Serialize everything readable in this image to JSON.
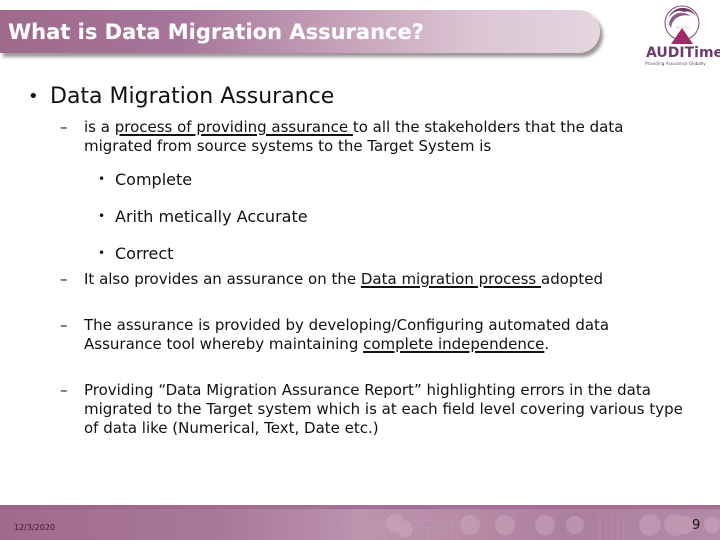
{
  "slide": {
    "title": "What is Data Migration Assurance?",
    "colors": {
      "banner_start": "#9e6a8c",
      "banner_end": "#e4d6df",
      "title_text": "#ffffff",
      "logo_purple": "#6d3c6c",
      "logo_magenta": "#a02a6a",
      "footer": "#a8789a"
    }
  },
  "logo": {
    "icon": "auditime-logo-icon",
    "name": "AUDITime",
    "tagline": "Providing Assurance Globally"
  },
  "content": {
    "heading": "Data Migration Assurance",
    "items": [
      {
        "pre": "is a ",
        "underlined": "process of providing assurance ",
        "post": "to all the stakeholders that the data migrated from source systems to the Target System is"
      },
      {
        "pre": "It also provides an assurance on the ",
        "underlined": "Data migration process ",
        "post": "adopted"
      },
      {
        "pre": "The assurance is provided by developing/Configuring automated data Assurance tool whereby maintaining ",
        "underlined": "complete independence",
        "post": "."
      },
      {
        "pre": "Providing “Data Migration Assurance Report” highlighting errors in the data migrated to the Target system which is at each field level covering various type of data like (Numerical, Text, Date etc.)",
        "underlined": "",
        "post": ""
      }
    ],
    "sub_bullets": [
      "Complete",
      "Arith metically Accurate",
      "Correct"
    ],
    "bullet_glyph": "•",
    "dash_glyph": "–"
  },
  "footer": {
    "date": "12/3/2020",
    "page_number": "9"
  }
}
